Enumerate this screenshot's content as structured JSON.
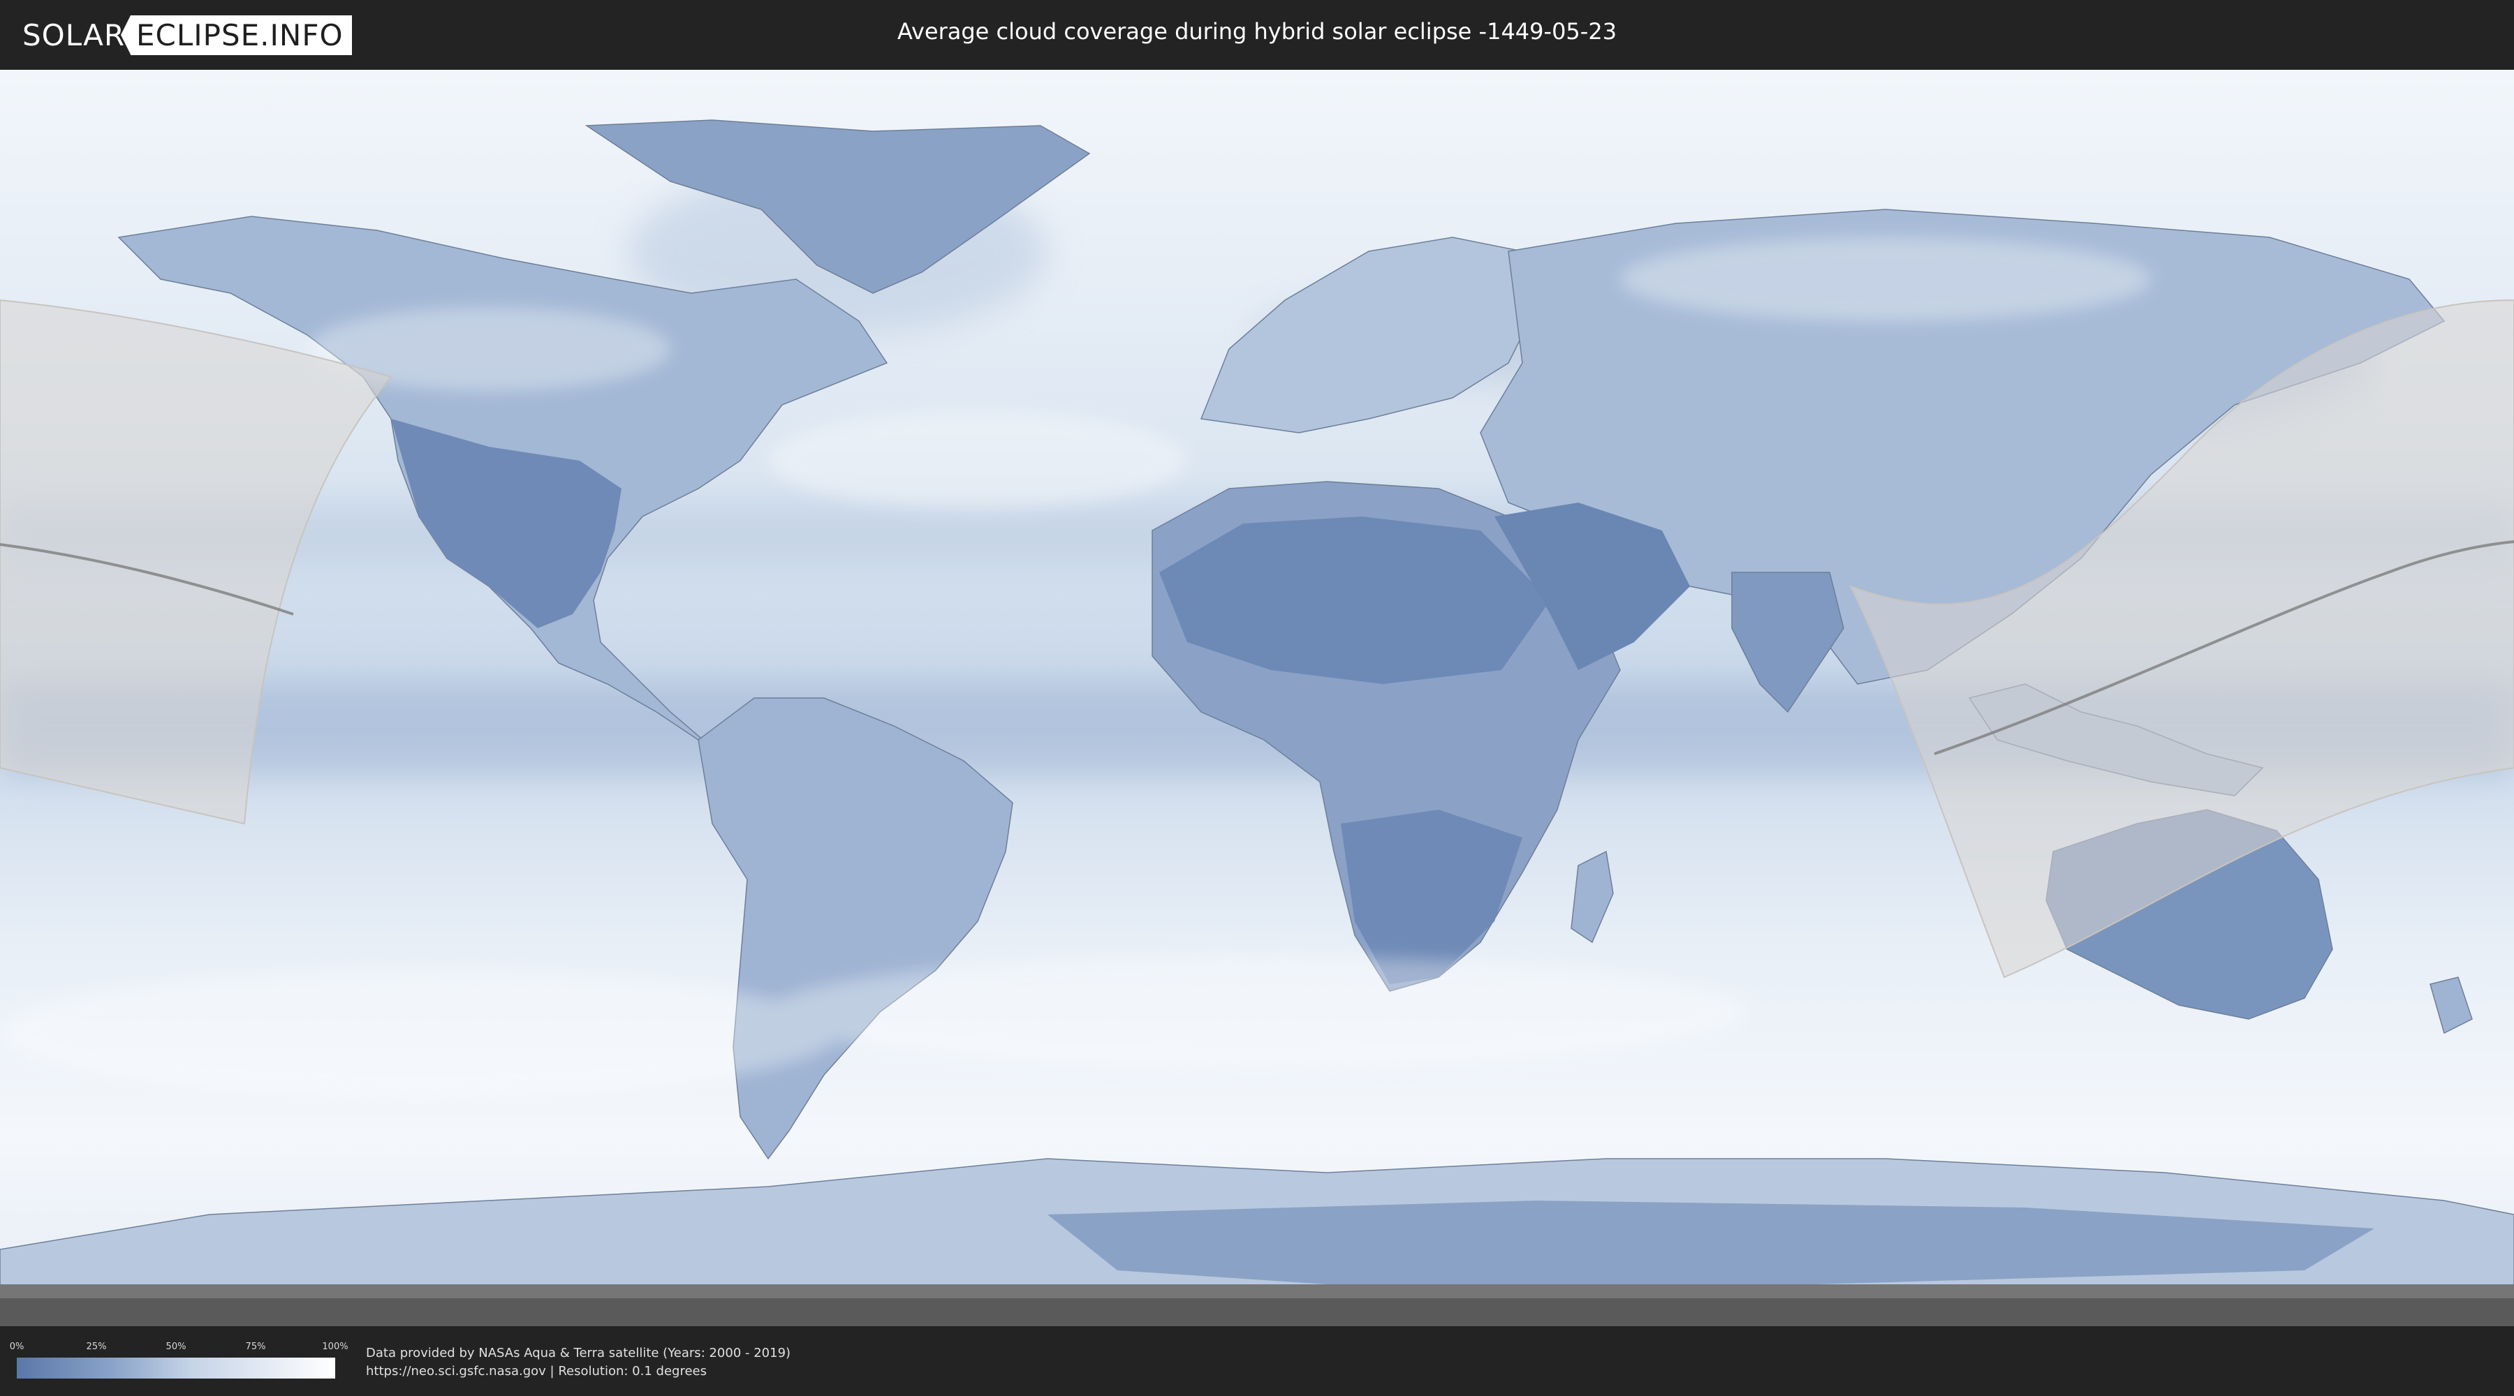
{
  "header": {
    "logo_left": "SOLAR",
    "logo_right": "ECLIPSE.INFO",
    "title": "Average cloud coverage during hybrid solar eclipse -1449-05-23"
  },
  "legend": {
    "ticks": [
      "0%",
      "25%",
      "50%",
      "75%",
      "100%"
    ],
    "color_low": "#5a77a8",
    "color_high": "#ffffff"
  },
  "footer": {
    "credit_line1": "Data provided by NASAs Aqua & Terra satellite (Years: 2000 - 2019)",
    "credit_line2": "https://neo.sci.gsfc.nasa.gov | Resolution: 0.1 degrees"
  },
  "colors": {
    "background": "#232323",
    "ocean_clear": "#eef3f9",
    "land_cloudless": "#6f8ab7",
    "eclipse_zone": "#d9d6d2"
  }
}
